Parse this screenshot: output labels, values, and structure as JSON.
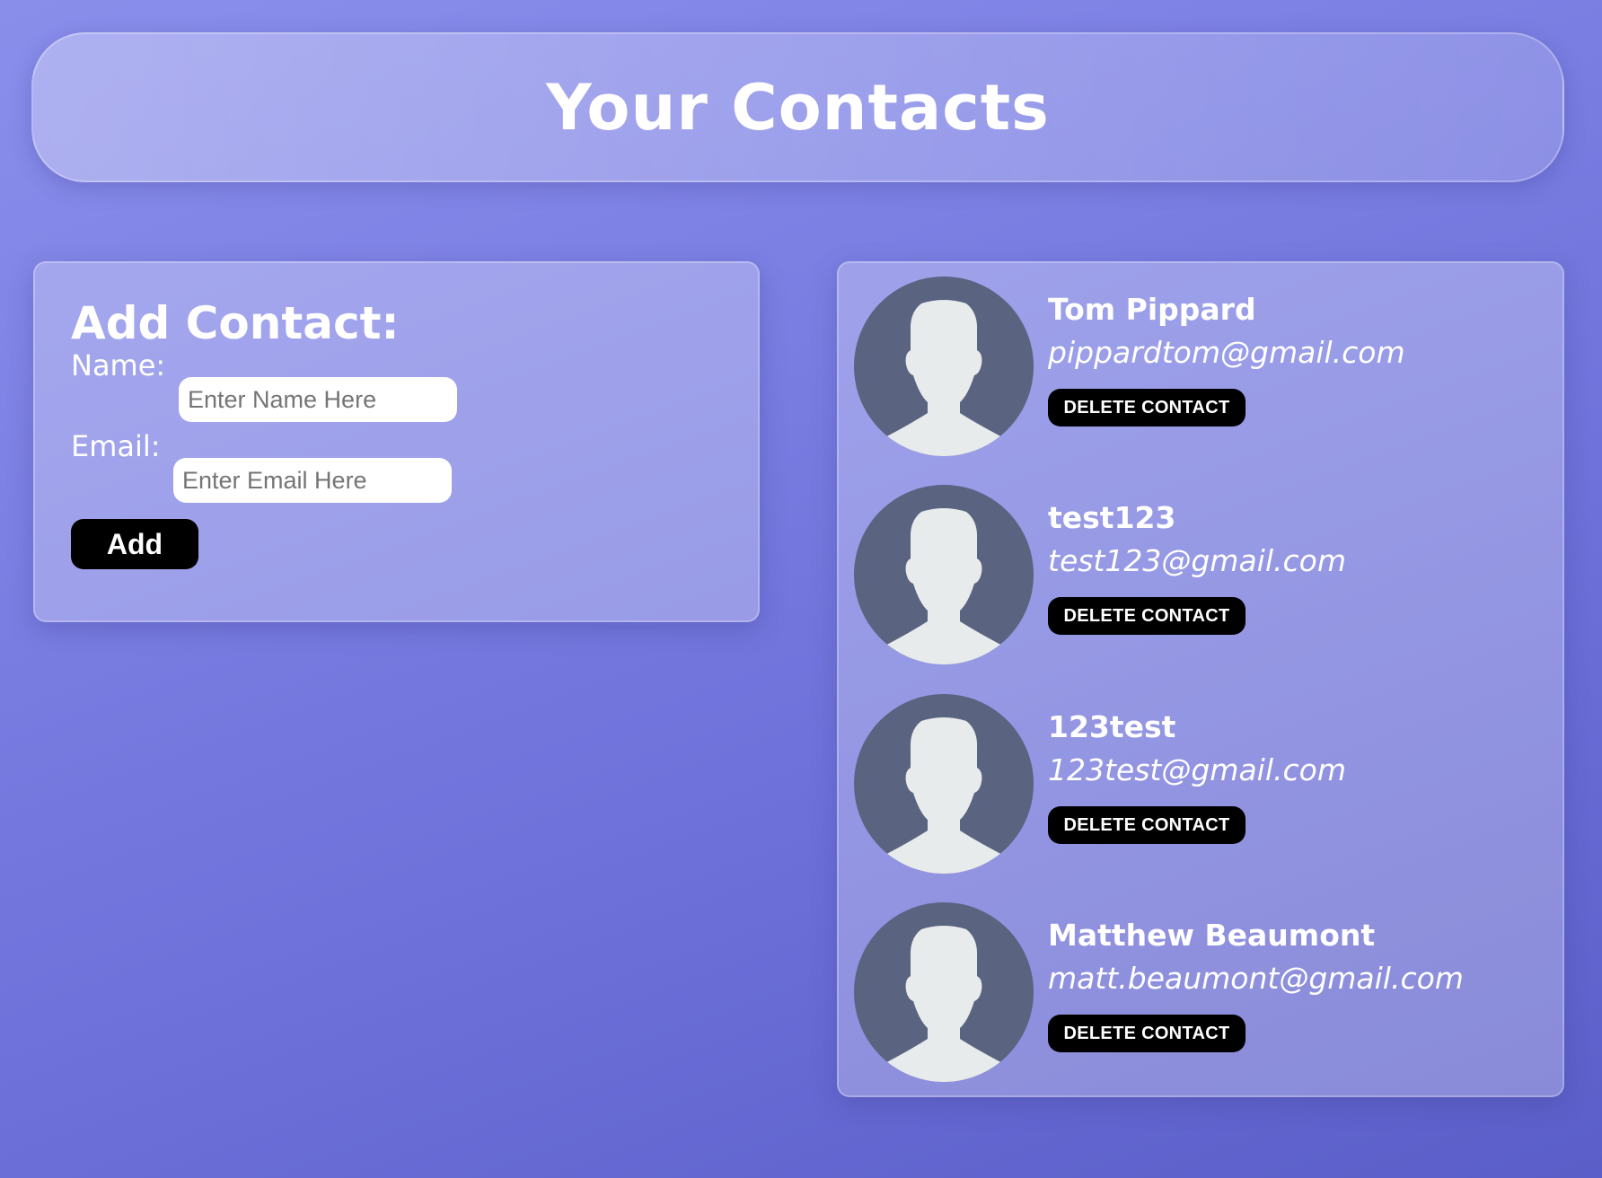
{
  "header": {
    "title": "Your Contacts"
  },
  "add_contact": {
    "title": "Add Contact:",
    "name_label": "Name:",
    "name_placeholder": "Enter Name Here",
    "name_value": "",
    "email_label": "Email:",
    "email_placeholder": "Enter Email Here",
    "email_value": "",
    "add_label": "Add"
  },
  "contacts": [
    {
      "name": "Tom Pippard",
      "email": "pippardtom@gmail.com",
      "delete_label": "DELETE CONTACT",
      "avatar_icon": "user-silhouette-icon"
    },
    {
      "name": "test123",
      "email": "test123@gmail.com",
      "delete_label": "DELETE CONTACT",
      "avatar_icon": "user-silhouette-icon"
    },
    {
      "name": "123test",
      "email": "123test@gmail.com",
      "delete_label": "DELETE CONTACT",
      "avatar_icon": "user-silhouette-icon"
    },
    {
      "name": "Matthew Beaumont",
      "email": "matt.beaumont@gmail.com",
      "delete_label": "DELETE CONTACT",
      "avatar_icon": "user-silhouette-icon"
    }
  ],
  "colors": {
    "background_start": "#8a8eeb",
    "background_end": "#5b5ec8",
    "avatar_circle": "#5a6380",
    "avatar_figure": "#e8ebec",
    "button": "#000000",
    "text": "#ffffff"
  }
}
